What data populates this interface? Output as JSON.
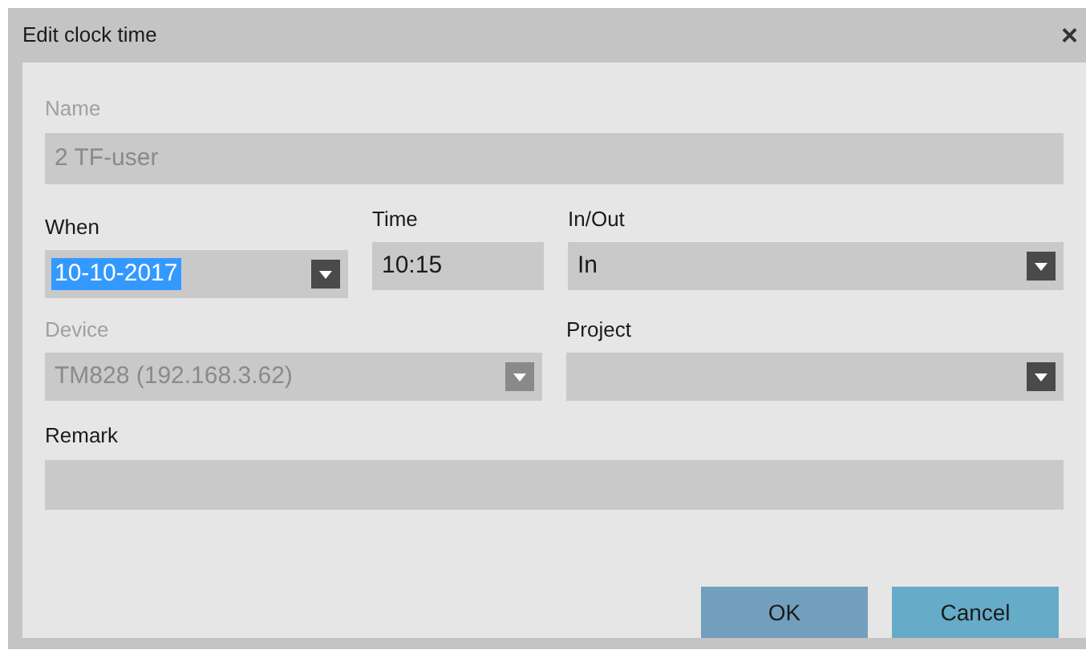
{
  "window": {
    "title": "Edit clock time",
    "close": "×"
  },
  "name": {
    "label": "Name",
    "value": "2 TF-user",
    "disabled": true
  },
  "when": {
    "label": "When",
    "value": "10-10-2017",
    "kind": "dropdown",
    "disabled": false,
    "highlighted": true
  },
  "time": {
    "label": "Time",
    "value": "10:15",
    "kind": "text",
    "disabled": false
  },
  "in_out": {
    "label": "In/Out",
    "value": "In",
    "kind": "dropdown",
    "disabled": false
  },
  "device": {
    "label": "Device",
    "value": "TM828 (192.168.3.62)",
    "kind": "dropdown",
    "disabled": true
  },
  "project": {
    "label": "Project",
    "kind": "dropdown",
    "disabled": false
  },
  "remark": {
    "label": "Remark",
    "disabled": false
  },
  "buttons": [
    {
      "label": "OK",
      "kind": "primary"
    },
    {
      "label": "Cancel",
      "kind": "secondary"
    }
  ]
}
